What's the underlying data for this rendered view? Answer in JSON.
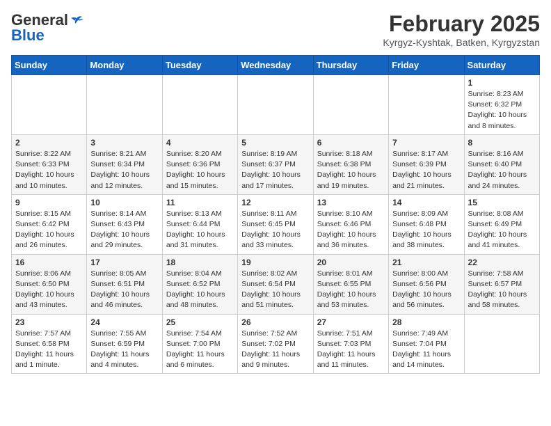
{
  "logo": {
    "line1": "General",
    "line2": "Blue"
  },
  "title": "February 2025",
  "subtitle": "Kyrgyz-Kyshtak, Batken, Kyrgyzstan",
  "headers": [
    "Sunday",
    "Monday",
    "Tuesday",
    "Wednesday",
    "Thursday",
    "Friday",
    "Saturday"
  ],
  "weeks": [
    [
      {
        "day": "",
        "info": ""
      },
      {
        "day": "",
        "info": ""
      },
      {
        "day": "",
        "info": ""
      },
      {
        "day": "",
        "info": ""
      },
      {
        "day": "",
        "info": ""
      },
      {
        "day": "",
        "info": ""
      },
      {
        "day": "1",
        "info": "Sunrise: 8:23 AM\nSunset: 6:32 PM\nDaylight: 10 hours and 8 minutes."
      }
    ],
    [
      {
        "day": "2",
        "info": "Sunrise: 8:22 AM\nSunset: 6:33 PM\nDaylight: 10 hours and 10 minutes."
      },
      {
        "day": "3",
        "info": "Sunrise: 8:21 AM\nSunset: 6:34 PM\nDaylight: 10 hours and 12 minutes."
      },
      {
        "day": "4",
        "info": "Sunrise: 8:20 AM\nSunset: 6:36 PM\nDaylight: 10 hours and 15 minutes."
      },
      {
        "day": "5",
        "info": "Sunrise: 8:19 AM\nSunset: 6:37 PM\nDaylight: 10 hours and 17 minutes."
      },
      {
        "day": "6",
        "info": "Sunrise: 8:18 AM\nSunset: 6:38 PM\nDaylight: 10 hours and 19 minutes."
      },
      {
        "day": "7",
        "info": "Sunrise: 8:17 AM\nSunset: 6:39 PM\nDaylight: 10 hours and 21 minutes."
      },
      {
        "day": "8",
        "info": "Sunrise: 8:16 AM\nSunset: 6:40 PM\nDaylight: 10 hours and 24 minutes."
      }
    ],
    [
      {
        "day": "9",
        "info": "Sunrise: 8:15 AM\nSunset: 6:42 PM\nDaylight: 10 hours and 26 minutes."
      },
      {
        "day": "10",
        "info": "Sunrise: 8:14 AM\nSunset: 6:43 PM\nDaylight: 10 hours and 29 minutes."
      },
      {
        "day": "11",
        "info": "Sunrise: 8:13 AM\nSunset: 6:44 PM\nDaylight: 10 hours and 31 minutes."
      },
      {
        "day": "12",
        "info": "Sunrise: 8:11 AM\nSunset: 6:45 PM\nDaylight: 10 hours and 33 minutes."
      },
      {
        "day": "13",
        "info": "Sunrise: 8:10 AM\nSunset: 6:46 PM\nDaylight: 10 hours and 36 minutes."
      },
      {
        "day": "14",
        "info": "Sunrise: 8:09 AM\nSunset: 6:48 PM\nDaylight: 10 hours and 38 minutes."
      },
      {
        "day": "15",
        "info": "Sunrise: 8:08 AM\nSunset: 6:49 PM\nDaylight: 10 hours and 41 minutes."
      }
    ],
    [
      {
        "day": "16",
        "info": "Sunrise: 8:06 AM\nSunset: 6:50 PM\nDaylight: 10 hours and 43 minutes."
      },
      {
        "day": "17",
        "info": "Sunrise: 8:05 AM\nSunset: 6:51 PM\nDaylight: 10 hours and 46 minutes."
      },
      {
        "day": "18",
        "info": "Sunrise: 8:04 AM\nSunset: 6:52 PM\nDaylight: 10 hours and 48 minutes."
      },
      {
        "day": "19",
        "info": "Sunrise: 8:02 AM\nSunset: 6:54 PM\nDaylight: 10 hours and 51 minutes."
      },
      {
        "day": "20",
        "info": "Sunrise: 8:01 AM\nSunset: 6:55 PM\nDaylight: 10 hours and 53 minutes."
      },
      {
        "day": "21",
        "info": "Sunrise: 8:00 AM\nSunset: 6:56 PM\nDaylight: 10 hours and 56 minutes."
      },
      {
        "day": "22",
        "info": "Sunrise: 7:58 AM\nSunset: 6:57 PM\nDaylight: 10 hours and 58 minutes."
      }
    ],
    [
      {
        "day": "23",
        "info": "Sunrise: 7:57 AM\nSunset: 6:58 PM\nDaylight: 11 hours and 1 minute."
      },
      {
        "day": "24",
        "info": "Sunrise: 7:55 AM\nSunset: 6:59 PM\nDaylight: 11 hours and 4 minutes."
      },
      {
        "day": "25",
        "info": "Sunrise: 7:54 AM\nSunset: 7:00 PM\nDaylight: 11 hours and 6 minutes."
      },
      {
        "day": "26",
        "info": "Sunrise: 7:52 AM\nSunset: 7:02 PM\nDaylight: 11 hours and 9 minutes."
      },
      {
        "day": "27",
        "info": "Sunrise: 7:51 AM\nSunset: 7:03 PM\nDaylight: 11 hours and 11 minutes."
      },
      {
        "day": "28",
        "info": "Sunrise: 7:49 AM\nSunset: 7:04 PM\nDaylight: 11 hours and 14 minutes."
      },
      {
        "day": "",
        "info": ""
      }
    ]
  ]
}
